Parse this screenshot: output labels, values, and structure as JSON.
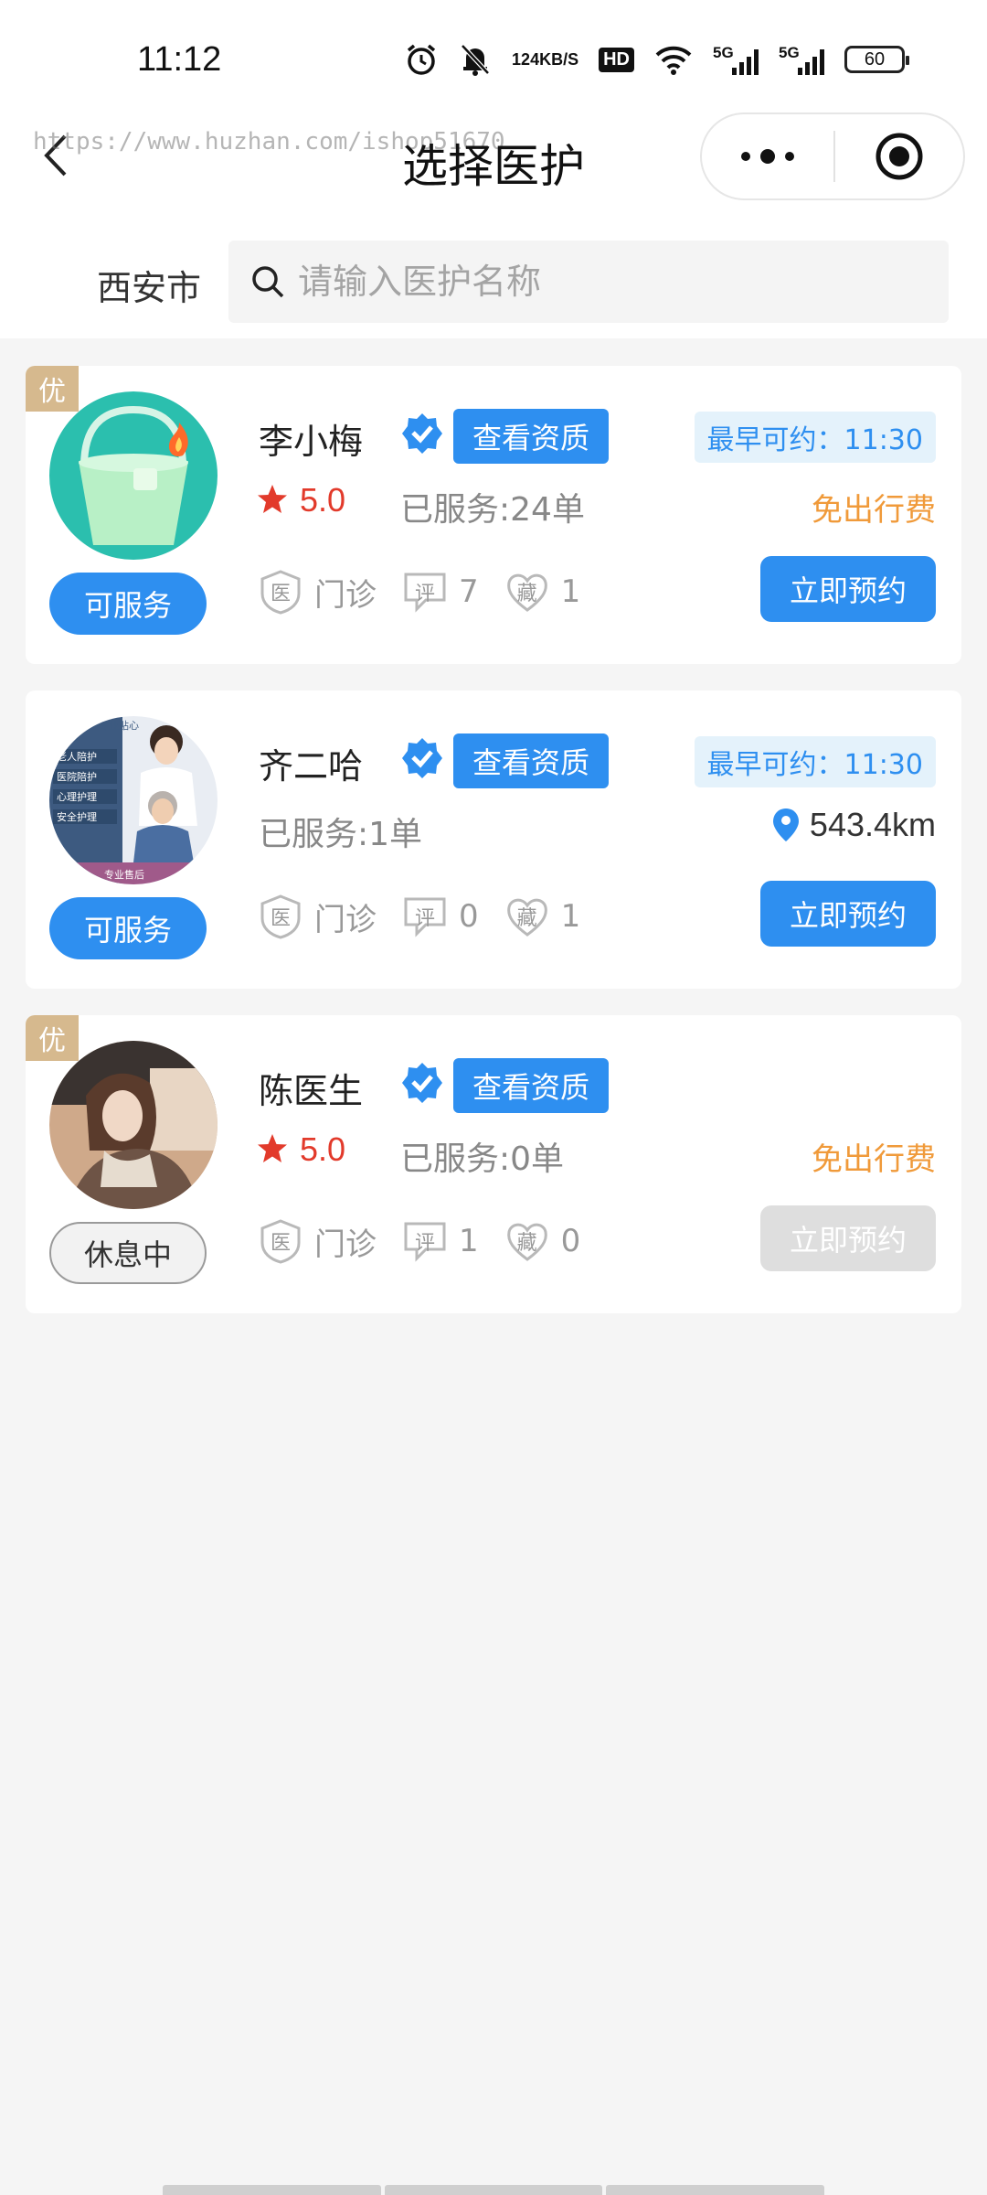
{
  "status_bar": {
    "time": "11:12",
    "net_speed_top": "124",
    "net_speed_bottom": "KB/S",
    "hd_label": "HD",
    "signal1_label": "5G",
    "signal2_label": "5G",
    "battery_level": "60"
  },
  "nav": {
    "title": "选择医护",
    "watermark": "https://www.huzhan.com/ishop51670"
  },
  "search": {
    "city": "西安市",
    "placeholder": "请输入医护名称",
    "value": ""
  },
  "colors": {
    "primary": "#2e8ff0",
    "rating_red": "#e23a2b",
    "free_orange": "#f09a3a",
    "badge_gold": "#d6b98e"
  },
  "providers": [
    {
      "badge": "优",
      "avatar_icon": "bucket-icon",
      "status": "可服务",
      "name": "李小梅",
      "cred_label": "查看资质",
      "earliest": "最早可约：11:30",
      "rating": "5.0",
      "served": "已服务:24单",
      "free_travel": "免出行费",
      "clinic_icon_char": "医",
      "clinic_label": "门诊",
      "review_icon_char": "评",
      "reviews": "7",
      "fav_icon_char": "藏",
      "favorites": "1",
      "book_label": "立即预约"
    },
    {
      "avatar_tags": [
        "专业贴心",
        "老人陪护",
        "医院陪护",
        "心理护理",
        "安全护理",
        "专业售后"
      ],
      "status": "可服务",
      "name": "齐二哈",
      "cred_label": "查看资质",
      "earliest": "最早可约：11:30",
      "served": "已服务:1单",
      "distance": "543.4km",
      "clinic_icon_char": "医",
      "clinic_label": "门诊",
      "review_icon_char": "评",
      "reviews": "0",
      "fav_icon_char": "藏",
      "favorites": "1",
      "book_label": "立即预约"
    },
    {
      "badge": "优",
      "status": "休息中",
      "name": "陈医生",
      "cred_label": "查看资质",
      "rating": "5.0",
      "served": "已服务:0单",
      "free_travel": "免出行费",
      "clinic_icon_char": "医",
      "clinic_label": "门诊",
      "review_icon_char": "评",
      "reviews": "1",
      "fav_icon_char": "藏",
      "favorites": "0",
      "book_label": "立即预约"
    }
  ]
}
